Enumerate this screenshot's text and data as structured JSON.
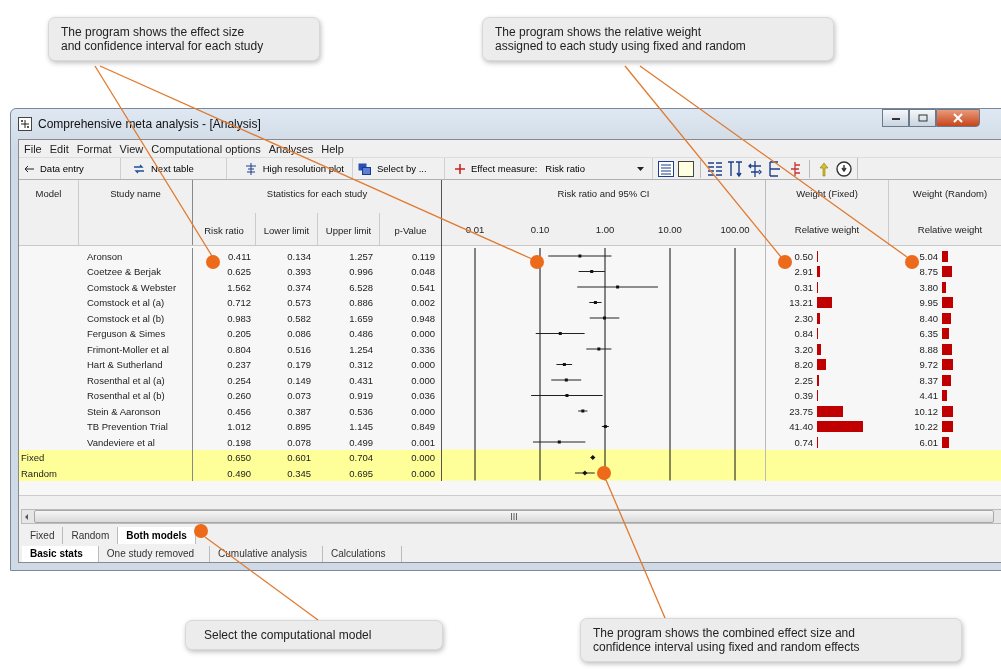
{
  "callouts": [
    {
      "text": "The program shows the effect size\nand confidence interval for each study"
    },
    {
      "text": "The program shows the relative weight\nassigned to each study using fixed and random"
    },
    {
      "text": "Select the computational model"
    },
    {
      "text": "The program shows the combined effect size and\nconfidence interval using fixed and random effects"
    }
  ],
  "window": {
    "title": "Comprehensive meta analysis - [Analysis]"
  },
  "menu": [
    "File",
    "Edit",
    "Format",
    "View",
    "Computational options",
    "Analyses",
    "Help"
  ],
  "toolbar": [
    {
      "kind": "button",
      "label": "Data entry"
    },
    {
      "kind": "button",
      "label": "Next table"
    },
    {
      "kind": "button",
      "label": "High resolution plot"
    },
    {
      "kind": "button",
      "label": "Select by ..."
    },
    {
      "kind": "dropdown",
      "label": "Effect measure:",
      "value": "Risk ratio"
    }
  ],
  "table": {
    "header": {
      "model": "Model",
      "study": "Study name",
      "stats": "Statistics for each study",
      "stat_columns": [
        "Risk ratio",
        "Lower limit",
        "Upper limit",
        "p-Value"
      ],
      "plot": "Risk ratio and 95% CI",
      "plot_ticks": [
        "0.01",
        "0.10",
        "1.00",
        "10.00",
        "100.00"
      ],
      "weight_fixed": "Weight (Fixed)",
      "weight_random": "Weight (Random)",
      "weight_sub": [
        "Relative weight",
        "Relative weight"
      ]
    },
    "rows": [
      {
        "kind": "study",
        "name": "Aronson",
        "stats": [
          "0.411",
          "0.134",
          "1.257",
          "0.119"
        ],
        "weight_fixed": {
          "value": "0.50"
        },
        "weight_random": {
          "value": "5.04"
        }
      },
      {
        "kind": "study",
        "name": "Coetzee & Berjak",
        "stats": [
          "0.625",
          "0.393",
          "0.996",
          "0.048"
        ],
        "weight_fixed": {
          "value": "2.91"
        },
        "weight_random": {
          "value": "8.75"
        }
      },
      {
        "kind": "study",
        "name": "Comstock & Webster",
        "stats": [
          "1.562",
          "0.374",
          "6.528",
          "0.541"
        ],
        "weight_fixed": {
          "value": "0.31"
        },
        "weight_random": {
          "value": "3.80"
        }
      },
      {
        "kind": "study",
        "name": "Comstock et al (a)",
        "stats": [
          "0.712",
          "0.573",
          "0.886",
          "0.002"
        ],
        "weight_fixed": {
          "value": "13.21"
        },
        "weight_random": {
          "value": "9.95"
        }
      },
      {
        "kind": "study",
        "name": "Comstock et al (b)",
        "stats": [
          "0.983",
          "0.582",
          "1.659",
          "0.948"
        ],
        "weight_fixed": {
          "value": "2.30"
        },
        "weight_random": {
          "value": "8.40"
        }
      },
      {
        "kind": "study",
        "name": "Ferguson & Simes",
        "stats": [
          "0.205",
          "0.086",
          "0.486",
          "0.000"
        ],
        "weight_fixed": {
          "value": "0.84"
        },
        "weight_random": {
          "value": "6.35"
        }
      },
      {
        "kind": "study",
        "name": "Frimont-Moller et al",
        "stats": [
          "0.804",
          "0.516",
          "1.254",
          "0.336"
        ],
        "weight_fixed": {
          "value": "3.20"
        },
        "weight_random": {
          "value": "8.88"
        }
      },
      {
        "kind": "study",
        "name": "Hart & Sutherland",
        "stats": [
          "0.237",
          "0.179",
          "0.312",
          "0.000"
        ],
        "weight_fixed": {
          "value": "8.20"
        },
        "weight_random": {
          "value": "9.72"
        }
      },
      {
        "kind": "study",
        "name": "Rosenthal et al (a)",
        "stats": [
          "0.254",
          "0.149",
          "0.431",
          "0.000"
        ],
        "weight_fixed": {
          "value": "2.25"
        },
        "weight_random": {
          "value": "8.37"
        }
      },
      {
        "kind": "study",
        "name": "Rosenthal et al (b)",
        "stats": [
          "0.260",
          "0.073",
          "0.919",
          "0.036"
        ],
        "weight_fixed": {
          "value": "0.39"
        },
        "weight_random": {
          "value": "4.41"
        }
      },
      {
        "kind": "study",
        "name": "Stein & Aaronson",
        "stats": [
          "0.456",
          "0.387",
          "0.536",
          "0.000"
        ],
        "weight_fixed": {
          "value": "23.75"
        },
        "weight_random": {
          "value": "10.12"
        }
      },
      {
        "kind": "study",
        "name": "TB Prevention Trial",
        "stats": [
          "1.012",
          "0.895",
          "1.145",
          "0.849"
        ],
        "weight_fixed": {
          "value": "41.40"
        },
        "weight_random": {
          "value": "10.22"
        }
      },
      {
        "kind": "study",
        "name": "Vandeviere et al",
        "stats": [
          "0.198",
          "0.078",
          "0.499",
          "0.001"
        ],
        "weight_fixed": {
          "value": "0.74"
        },
        "weight_random": {
          "value": "6.01"
        }
      },
      {
        "kind": "summary",
        "model": "Fixed",
        "stats": [
          "0.650",
          "0.601",
          "0.704",
          "0.000"
        ]
      },
      {
        "kind": "summary",
        "model": "Random",
        "stats": [
          "0.490",
          "0.345",
          "0.695",
          "0.000"
        ]
      }
    ]
  },
  "model_tabs": [
    {
      "label": "Fixed",
      "selected": false
    },
    {
      "label": "Random",
      "selected": false
    },
    {
      "label": "Both models",
      "selected": true
    }
  ],
  "analysis_tabs": [
    {
      "label": "Basic stats",
      "selected": true
    },
    {
      "label": "One study removed",
      "selected": false
    },
    {
      "label": "Cumulative analysis",
      "selected": false
    },
    {
      "label": "Calculations",
      "selected": false
    }
  ]
}
